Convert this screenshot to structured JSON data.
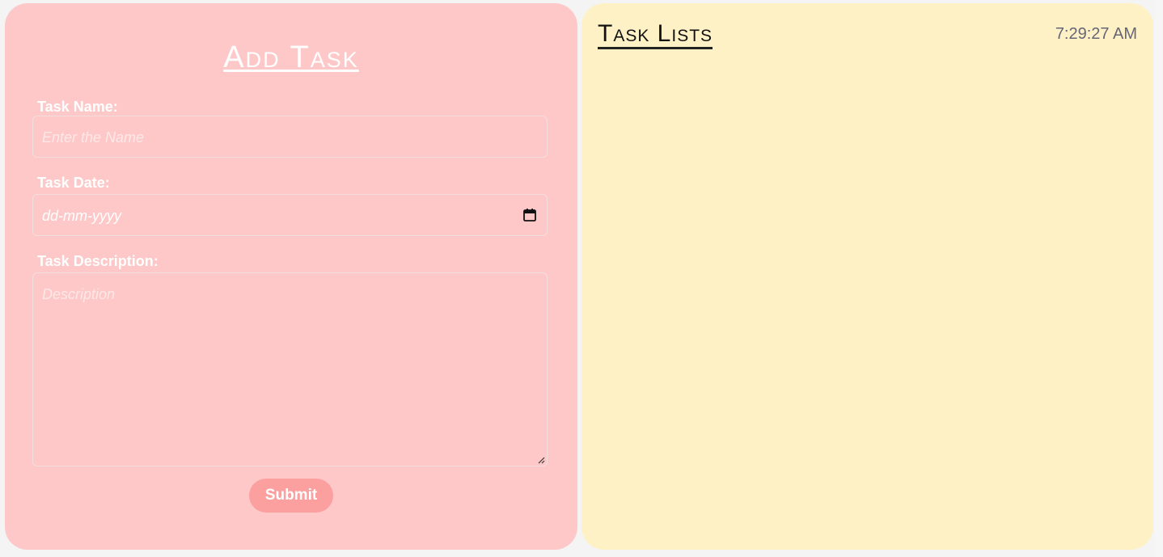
{
  "add_task": {
    "title": "Add Task",
    "name_label": "Task Name:",
    "name_placeholder": "Enter the Name",
    "date_label": "Task Date:",
    "date_value": "dd-mm-yyyy",
    "description_label": "Task Description:",
    "description_placeholder": "Description",
    "submit_label": "Submit"
  },
  "task_lists": {
    "title": "Task Lists",
    "clock": "7:29:27 AM"
  },
  "colors": {
    "add_panel_bg": "#fec8c8",
    "list_panel_bg": "#fdf1c5",
    "submit_bg": "#fb9f9f"
  },
  "icons": {
    "date_picker": "calendar-icon",
    "textarea_resize": "resize-grip-icon"
  }
}
